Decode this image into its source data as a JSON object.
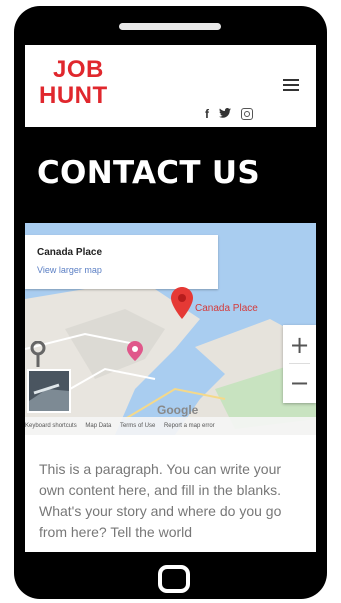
{
  "header": {
    "logo_line1": "JOB",
    "logo_line2": "HUNT",
    "social_icons": [
      "facebook-icon",
      "twitter-icon",
      "instagram-icon"
    ],
    "menu_icon": "hamburger-icon"
  },
  "hero": {
    "title": "CONTACT US"
  },
  "map": {
    "place_name": "Canada Place",
    "view_larger": "View larger map",
    "marker_label": "Canada Place",
    "zoom_in": "+",
    "zoom_out": "−",
    "provider": "Google",
    "attribution": [
      "Keyboard shortcuts",
      "Map Data",
      "Terms of Use",
      "Report a map error"
    ]
  },
  "content": {
    "paragraph": "This is a paragraph. You can write your own content here, and fill in the blanks. What's your story and where do you go from here? Tell the world"
  },
  "colors": {
    "brand": "#e0272d",
    "hero_bg": "#000000",
    "water": "#a9cdf0"
  }
}
